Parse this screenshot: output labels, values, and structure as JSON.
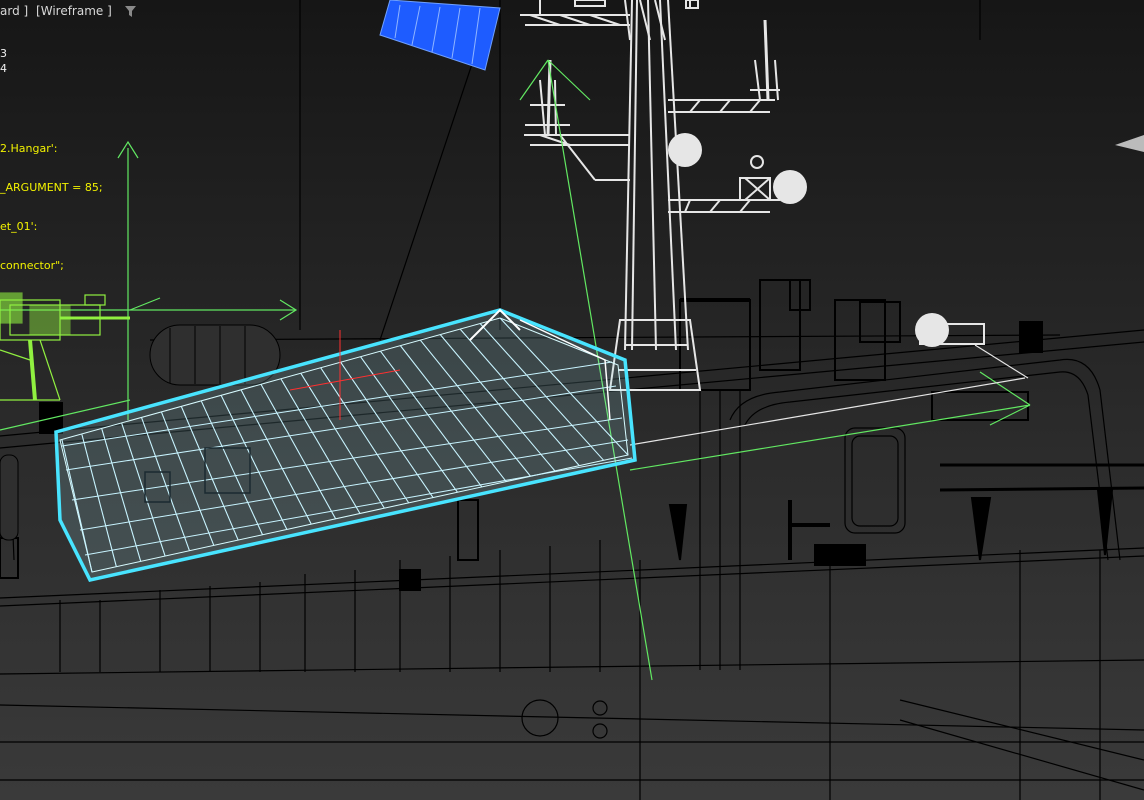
{
  "viewport": {
    "label_view": "ard ]",
    "label_mode": "[Wireframe ]",
    "filter_icon": "funnel-icon"
  },
  "stats": {
    "line1": "3",
    "line2": "4"
  },
  "script_lines": [
    "2.Hangar':",
    "_ARGUMENT = 85;",
    "et_01':",
    "connector\";"
  ],
  "colors": {
    "background": "#2b2b2b",
    "wire": "#000000",
    "mast": "#e6e6e6",
    "selected": "#a8f0ff",
    "selected_outline": "#48e4ff",
    "gizmo": "#62e862",
    "gun": "#90f040",
    "blue_object": "#1e5cff",
    "script_text": "#f2f200"
  }
}
